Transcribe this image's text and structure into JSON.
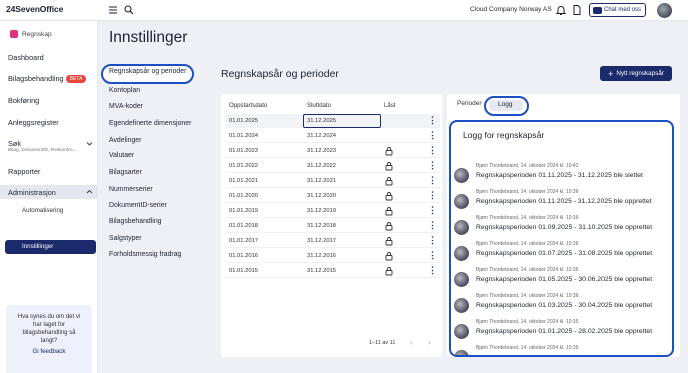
{
  "header": {
    "logo": "24SevenOffice",
    "company": "Cloud Company Norway AS",
    "chat_label": "Chat med oss"
  },
  "sidebar": {
    "module": "Regnskap",
    "items": [
      {
        "label": "Dashboard"
      },
      {
        "label": "Bilagsbehandling",
        "badge": "BETA"
      },
      {
        "label": "Bokføring"
      },
      {
        "label": "Anleggsregister"
      },
      {
        "label": "Søk",
        "sub": "Bilag, DokumentID, Reskontro,..."
      },
      {
        "label": "Rapporter"
      },
      {
        "label": "Administrasjon"
      }
    ],
    "subitems": [
      {
        "label": "Automatisering"
      },
      {
        "label": "Innstillinger"
      }
    ],
    "feedback": {
      "question": "Hva synes du om det vi har laget for bilagsbehandling så langt?",
      "link": "Gi feedback"
    }
  },
  "page": {
    "title": "Innstillinger"
  },
  "settings_menu": [
    "Regnskapsår og perioder",
    "Kontoplan",
    "MVA-koder",
    "Egendefinerte dimensjoner",
    "Avdelinger",
    "Valutaer",
    "Bilagsarter",
    "Nummerserier",
    "DokumentID-serier",
    "Bilagsbehandling",
    "Salgstyper",
    "Forholdsmessig fradrag"
  ],
  "panel": {
    "title": "Regnskapsår og perioder",
    "new_button": "Nytt regnskapsår"
  },
  "table": {
    "headers": {
      "start": "Oppstartsdato",
      "end": "Sluttdato",
      "locked": "Låst"
    },
    "rows": [
      {
        "start": "01.01.2025",
        "end": "31.12.2025",
        "locked": false
      },
      {
        "start": "01.01.2024",
        "end": "31.12.2024",
        "locked": false
      },
      {
        "start": "01.01.2023",
        "end": "31.12.2023",
        "locked": true
      },
      {
        "start": "01.01.2022",
        "end": "31.12.2022",
        "locked": true
      },
      {
        "start": "01.01.2021",
        "end": "31.12.2021",
        "locked": true
      },
      {
        "start": "01.01.2020",
        "end": "31.12.2020",
        "locked": true
      },
      {
        "start": "01.01.2019",
        "end": "31.12.2019",
        "locked": true
      },
      {
        "start": "01.01.2018",
        "end": "31.12.2018",
        "locked": true
      },
      {
        "start": "01.01.2017",
        "end": "31.12.2017",
        "locked": true
      },
      {
        "start": "01.01.2016",
        "end": "31.12.2016",
        "locked": true
      },
      {
        "start": "01.01.2015",
        "end": "31.12.2015",
        "locked": true
      }
    ],
    "pager": "1–11 av 11"
  },
  "tabs": {
    "perioder": "Perioder",
    "logg": "Logg"
  },
  "log": {
    "title": "Logg for regnskapsår",
    "entries": [
      {
        "meta": "Bjørn Thordebrand, 14. oktober 2024 kl. 10:42",
        "text": "Regnskapsperioden 01.11.2025 - 31.12.2025 ble slettet"
      },
      {
        "meta": "Bjørn Thordebrand, 14. oktober 2024 kl. 10:36",
        "text": "Regnskapsperioden 01.11.2025 - 31.12.2025 ble opprettet"
      },
      {
        "meta": "Bjørn Thordebrand, 14. oktober 2024 kl. 10:36",
        "text": "Regnskapsperioden 01.09.2025 - 31.10.2025 ble opprettet"
      },
      {
        "meta": "Bjørn Thordebrand, 14. oktober 2024 kl. 10:36",
        "text": "Regnskapsperioden 01.07.2025 - 31.08.2025 ble opprettet"
      },
      {
        "meta": "Bjørn Thordebrand, 14. oktober 2024 kl. 10:36",
        "text": "Regnskapsperioden 01.05.2025 - 30.06.2025 ble opprettet"
      },
      {
        "meta": "Bjørn Thordebrand, 14. oktober 2024 kl. 10:36",
        "text": "Regnskapsperioden 01.03.2025 - 30.04.2025 ble opprettet"
      },
      {
        "meta": "Bjørn Thordebrand, 14. oktober 2024 kl. 10:35",
        "text": "Regnskapsperioden 01.01.2025 - 28.02.2025 ble opprettet"
      },
      {
        "meta": "Bjørn Thordebrand, 14. oktober 2024 kl. 10:35",
        "text": ""
      }
    ]
  },
  "colors": {
    "accent": "#1b2a6b",
    "highlight_outline": "#1b4fc2",
    "beta_badge": "#e8463c"
  }
}
